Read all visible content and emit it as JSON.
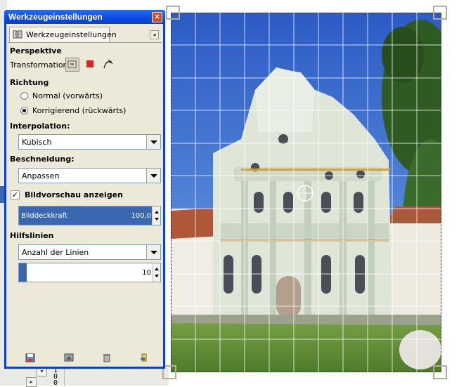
{
  "window": {
    "title": "Werkzeugeinstellungen"
  },
  "tab": {
    "label": "Werkzeugeinstellungen",
    "icon": "tool-options-icon"
  },
  "perspective": {
    "heading": "Perspektive",
    "transformation_label": "Transformation:",
    "modes": [
      "layer-transform-icon",
      "selection-transform-icon",
      "path-transform-icon"
    ]
  },
  "direction": {
    "heading": "Richtung",
    "options": [
      "Normal (vorwärts)",
      "Korrigierend (rückwärts)"
    ],
    "selected": "Korrigierend (rückwärts)"
  },
  "interpolation": {
    "heading": "Interpolation:",
    "value": "Kubisch"
  },
  "clipping": {
    "heading": "Beschneidung:",
    "value": "Anpassen"
  },
  "preview": {
    "label": "Bildvorschau anzeigen",
    "checked": true
  },
  "opacity": {
    "label": "Bilddeckkraft",
    "value": "100,0",
    "fraction": 1.0
  },
  "guides": {
    "heading": "Hilfslinien",
    "type": "Anzahl der Linien",
    "count": "10",
    "fraction": 0.06
  },
  "footer": {
    "icons": [
      "save-options-icon",
      "restore-options-icon",
      "delete-options-icon",
      "reset-options-icon"
    ]
  },
  "ruler": {
    "digits": [
      "1",
      "0",
      "0"
    ]
  },
  "colors": {
    "title_blue": "#0a4ae0",
    "accent": "#3a67b0",
    "close_red": "#d6462a"
  }
}
